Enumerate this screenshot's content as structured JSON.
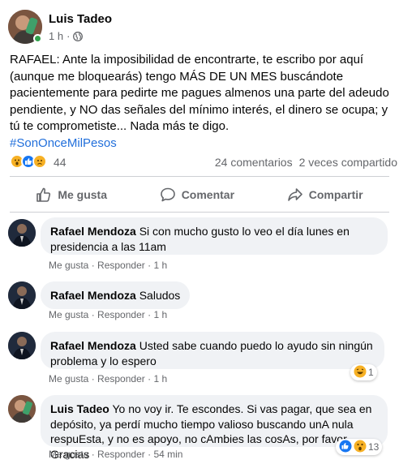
{
  "post": {
    "author": "Luis Tadeo",
    "time": "1 h",
    "dot": "·",
    "text": "RAFAEL: Ante la imposibilidad de encontrarte, te escribo por aquí (aunque me bloquearás) tengo MÁS DE UN MES buscándote pacientemente para pedirte me pagues almenos una parte del adeudo pendiente, y NO das señales del mínimo interés, el dinero se ocupa; y tú te comprometiste... Nada más te digo.",
    "hashtag": "#SonOnceMilPesos",
    "reaction_count": "44",
    "comments_count": "24 comentarios",
    "shares_count": "2 veces compartido"
  },
  "actions": {
    "like": "Me gusta",
    "comment": "Comentar",
    "share": "Compartir"
  },
  "comments": [
    {
      "name": "Rafael Mendoza",
      "text": "Si con mucho gusto lo veo el día lunes en presidencia a las 11am",
      "like": "Me gusta",
      "reply": "Responder",
      "time": "1 h",
      "sep": "·"
    },
    {
      "name": "Rafael Mendoza",
      "text": "Saludos",
      "like": "Me gusta",
      "reply": "Responder",
      "time": "1 h",
      "sep": "·"
    },
    {
      "name": "Rafael Mendoza",
      "text": "Usted sabe cuando puedo lo ayudo sin ningún problema y lo espero",
      "like": "Me gusta",
      "reply": "Responder",
      "time": "1 h",
      "sep": "·",
      "reaction_count": "1"
    },
    {
      "name": "Luis Tadeo",
      "text": "Yo no voy ir. Te escondes. Si vas pagar, que sea en depósito, ya perdí mucho tiempo valioso buscando unA nula respuEsta, y no es apoyo, no cAmbies las cosAs, por favor. Gracias",
      "like": "Me gusta",
      "reply": "Responder",
      "time": "54 min",
      "sep": "·",
      "reaction_count": "13"
    }
  ],
  "colors": {
    "link_blue": "#216fdb",
    "muted": "#65676b",
    "bubble": "#f0f2f5",
    "online": "#31a24c"
  }
}
